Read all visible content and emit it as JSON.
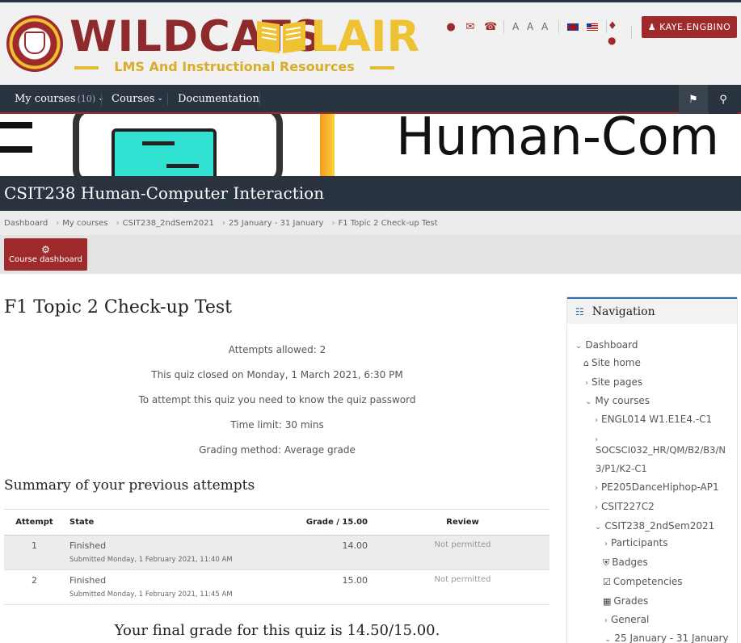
{
  "header": {
    "seal_label": "CEBU INSTITUTE OF TECHNOLOGY UNIVERSITY",
    "logo_main": "WILDCATS",
    "logo_lair": "LAIR",
    "logo_sub": "LMS And Instructional Resources",
    "aaa": "A A A",
    "user_button": "KAYE.ENGBINO",
    "icons": [
      "map-marker-icon",
      "envelope-icon",
      "phone-icon",
      "uk-flag-icon",
      "us-flag-icon",
      "bell-icon",
      "chat-icon",
      "user-icon"
    ]
  },
  "navbar": {
    "my_courses": "My courses",
    "my_courses_count": "(10)",
    "courses": "Courses",
    "documentation": "Documentation"
  },
  "banner": {
    "text": "Human-Com"
  },
  "course_title": "CSIT238 Human-Computer Interaction",
  "breadcrumb": [
    "Dashboard",
    "My courses",
    "CSIT238_2ndSem2021",
    "25 January - 31 January",
    "F1 Topic 2 Check-up Test"
  ],
  "course_dashboard_button": "Course dashboard",
  "quiz": {
    "title": "F1 Topic 2 Check-up Test",
    "info": [
      "Attempts allowed: 2",
      "This quiz closed on Monday, 1 March 2021, 6:30 PM",
      "To attempt this quiz you need to know the quiz password",
      "Time limit: 30 mins",
      "Grading method: Average grade"
    ],
    "summary_title": "Summary of your previous attempts",
    "columns": [
      "Attempt",
      "State",
      "Grade / 15.00",
      "Review"
    ],
    "attempts": [
      {
        "attempt": "1",
        "state": "Finished",
        "submitted": "Submitted Monday, 1 February 2021, 11:40 AM",
        "grade": "14.00",
        "review": "Not permitted"
      },
      {
        "attempt": "2",
        "state": "Finished",
        "submitted": "Submitted Monday, 1 February 2021, 11:45 AM",
        "grade": "15.00",
        "review": "Not permitted"
      }
    ],
    "final_grade": "Your final grade for this quiz is 14.50/15.00."
  },
  "navigation": {
    "title": "Navigation",
    "items": [
      "Dashboard",
      "Site home",
      "Site pages",
      "My courses",
      "ENGL014 W1.E1E4.-C1",
      "SOCSCI032_HR/QM/B2/B3/N",
      "3/P1/K2-C1",
      "PE205DanceHiphop-AP1",
      "CSIT227C2",
      "CSIT238_2ndSem2021",
      "Participants",
      "Badges",
      "Competencies",
      "Grades",
      "General",
      "25 January - 31 January"
    ]
  }
}
